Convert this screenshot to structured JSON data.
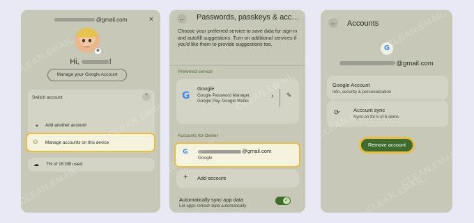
{
  "panel1": {
    "header_email_suffix": "@gmail.com",
    "close_icon_glyph": "×",
    "greeting_prefix": "Hi,",
    "greeting_suffix": "!",
    "manage_google_account_label": "Manage your Google Account",
    "switch_account_label": "Switch account",
    "switch_chevron_glyph": "⌃",
    "add_another_account_label": "Add another account",
    "add_icon_glyph": "+",
    "manage_accounts_label": "Manage accounts on this device",
    "manage_icon_glyph": "⚇",
    "storage_label": "7% of 15 GB used",
    "storage_icon_glyph": "☁",
    "storage_used_percent": 7
  },
  "panel2": {
    "back_glyph": "←",
    "title": "Passwords, passkeys & acc…",
    "description": "Choose your preferred service to save data for sign-in and autofill suggestions. Turn on additional services if you'd like them to provide suggestions too.",
    "preferred_service_header": "Preferred service",
    "preferred_name": "Google",
    "preferred_desc": "Google Password Manager, Google Pay, Google Wallet",
    "arrow_glyph": "›",
    "edit_glyph": "✎",
    "accounts_header": "Accounts for Owner",
    "owner_email_suffix": "@gmail.com",
    "owner_provider": "Google",
    "add_account_label": "Add account",
    "add_glyph": "+",
    "sync_label": "Automatically sync app data",
    "sync_sub": "Let apps refresh data automatically",
    "sync_enabled": true,
    "toggle_check": "✓"
  },
  "panel3": {
    "back_glyph": "←",
    "title": "Accounts",
    "email_suffix": "@gmail.com",
    "google_account_title": "Google Account",
    "google_account_sub": "Info, security & personalization",
    "account_sync_title": "Account sync",
    "account_sync_sub": "Sync on for 5 of 6 items",
    "sync_icon_glyph": "⟳",
    "remove_account_label": "Remove account"
  },
  "watermark_text": "CLEAN.EMAIL",
  "colors": {
    "background": "#e9e9f5",
    "panel": "#c7c8b7",
    "highlight_border": "#e9bd42",
    "accent_green": "#3f6b2c",
    "section_header": "#4d6a2c"
  },
  "icons": {
    "google_logo": "google-logo-icon",
    "avatar": "memoji-avatar",
    "camera": "camera-icon"
  }
}
